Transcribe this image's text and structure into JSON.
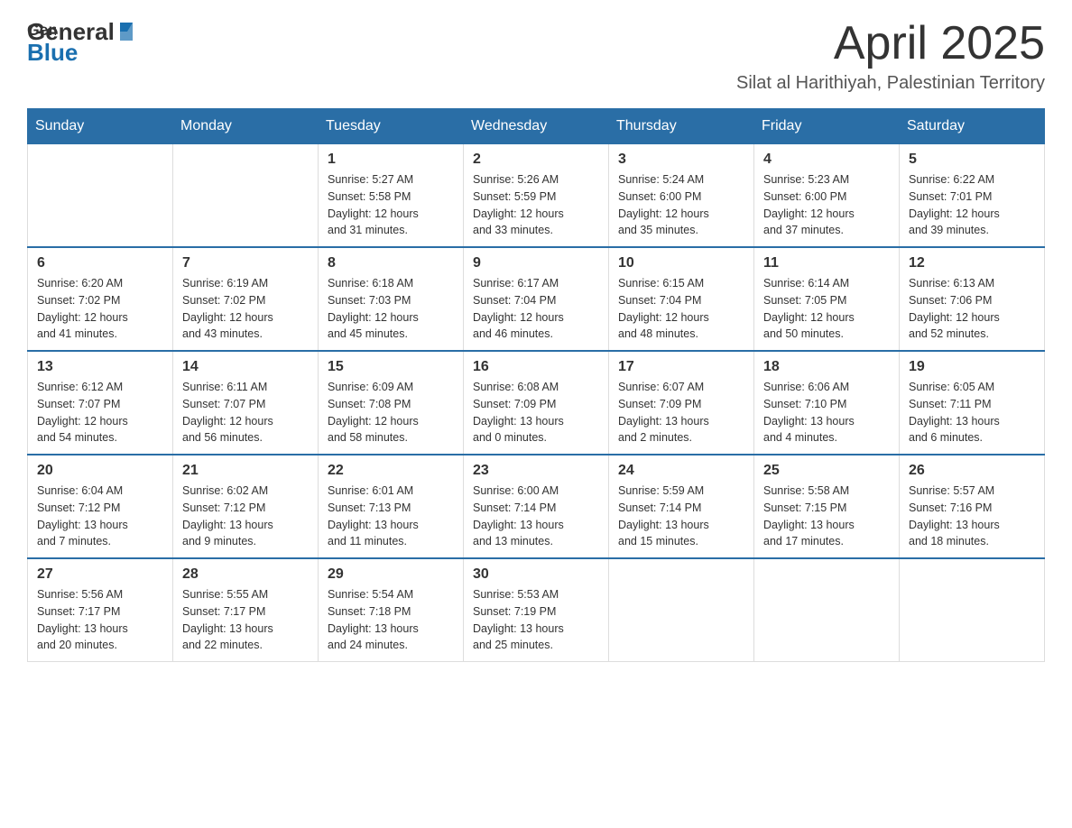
{
  "header": {
    "logo": {
      "text_general": "General",
      "text_blue": "Blue"
    },
    "title": "April 2025",
    "subtitle": "Silat al Harithiyah, Palestinian Territory"
  },
  "weekdays": [
    "Sunday",
    "Monday",
    "Tuesday",
    "Wednesday",
    "Thursday",
    "Friday",
    "Saturday"
  ],
  "weeks": [
    [
      {
        "day": "",
        "info": ""
      },
      {
        "day": "",
        "info": ""
      },
      {
        "day": "1",
        "info": "Sunrise: 5:27 AM\nSunset: 5:58 PM\nDaylight: 12 hours\nand 31 minutes."
      },
      {
        "day": "2",
        "info": "Sunrise: 5:26 AM\nSunset: 5:59 PM\nDaylight: 12 hours\nand 33 minutes."
      },
      {
        "day": "3",
        "info": "Sunrise: 5:24 AM\nSunset: 6:00 PM\nDaylight: 12 hours\nand 35 minutes."
      },
      {
        "day": "4",
        "info": "Sunrise: 5:23 AM\nSunset: 6:00 PM\nDaylight: 12 hours\nand 37 minutes."
      },
      {
        "day": "5",
        "info": "Sunrise: 6:22 AM\nSunset: 7:01 PM\nDaylight: 12 hours\nand 39 minutes."
      }
    ],
    [
      {
        "day": "6",
        "info": "Sunrise: 6:20 AM\nSunset: 7:02 PM\nDaylight: 12 hours\nand 41 minutes."
      },
      {
        "day": "7",
        "info": "Sunrise: 6:19 AM\nSunset: 7:02 PM\nDaylight: 12 hours\nand 43 minutes."
      },
      {
        "day": "8",
        "info": "Sunrise: 6:18 AM\nSunset: 7:03 PM\nDaylight: 12 hours\nand 45 minutes."
      },
      {
        "day": "9",
        "info": "Sunrise: 6:17 AM\nSunset: 7:04 PM\nDaylight: 12 hours\nand 46 minutes."
      },
      {
        "day": "10",
        "info": "Sunrise: 6:15 AM\nSunset: 7:04 PM\nDaylight: 12 hours\nand 48 minutes."
      },
      {
        "day": "11",
        "info": "Sunrise: 6:14 AM\nSunset: 7:05 PM\nDaylight: 12 hours\nand 50 minutes."
      },
      {
        "day": "12",
        "info": "Sunrise: 6:13 AM\nSunset: 7:06 PM\nDaylight: 12 hours\nand 52 minutes."
      }
    ],
    [
      {
        "day": "13",
        "info": "Sunrise: 6:12 AM\nSunset: 7:07 PM\nDaylight: 12 hours\nand 54 minutes."
      },
      {
        "day": "14",
        "info": "Sunrise: 6:11 AM\nSunset: 7:07 PM\nDaylight: 12 hours\nand 56 minutes."
      },
      {
        "day": "15",
        "info": "Sunrise: 6:09 AM\nSunset: 7:08 PM\nDaylight: 12 hours\nand 58 minutes."
      },
      {
        "day": "16",
        "info": "Sunrise: 6:08 AM\nSunset: 7:09 PM\nDaylight: 13 hours\nand 0 minutes."
      },
      {
        "day": "17",
        "info": "Sunrise: 6:07 AM\nSunset: 7:09 PM\nDaylight: 13 hours\nand 2 minutes."
      },
      {
        "day": "18",
        "info": "Sunrise: 6:06 AM\nSunset: 7:10 PM\nDaylight: 13 hours\nand 4 minutes."
      },
      {
        "day": "19",
        "info": "Sunrise: 6:05 AM\nSunset: 7:11 PM\nDaylight: 13 hours\nand 6 minutes."
      }
    ],
    [
      {
        "day": "20",
        "info": "Sunrise: 6:04 AM\nSunset: 7:12 PM\nDaylight: 13 hours\nand 7 minutes."
      },
      {
        "day": "21",
        "info": "Sunrise: 6:02 AM\nSunset: 7:12 PM\nDaylight: 13 hours\nand 9 minutes."
      },
      {
        "day": "22",
        "info": "Sunrise: 6:01 AM\nSunset: 7:13 PM\nDaylight: 13 hours\nand 11 minutes."
      },
      {
        "day": "23",
        "info": "Sunrise: 6:00 AM\nSunset: 7:14 PM\nDaylight: 13 hours\nand 13 minutes."
      },
      {
        "day": "24",
        "info": "Sunrise: 5:59 AM\nSunset: 7:14 PM\nDaylight: 13 hours\nand 15 minutes."
      },
      {
        "day": "25",
        "info": "Sunrise: 5:58 AM\nSunset: 7:15 PM\nDaylight: 13 hours\nand 17 minutes."
      },
      {
        "day": "26",
        "info": "Sunrise: 5:57 AM\nSunset: 7:16 PM\nDaylight: 13 hours\nand 18 minutes."
      }
    ],
    [
      {
        "day": "27",
        "info": "Sunrise: 5:56 AM\nSunset: 7:17 PM\nDaylight: 13 hours\nand 20 minutes."
      },
      {
        "day": "28",
        "info": "Sunrise: 5:55 AM\nSunset: 7:17 PM\nDaylight: 13 hours\nand 22 minutes."
      },
      {
        "day": "29",
        "info": "Sunrise: 5:54 AM\nSunset: 7:18 PM\nDaylight: 13 hours\nand 24 minutes."
      },
      {
        "day": "30",
        "info": "Sunrise: 5:53 AM\nSunset: 7:19 PM\nDaylight: 13 hours\nand 25 minutes."
      },
      {
        "day": "",
        "info": ""
      },
      {
        "day": "",
        "info": ""
      },
      {
        "day": "",
        "info": ""
      }
    ]
  ]
}
